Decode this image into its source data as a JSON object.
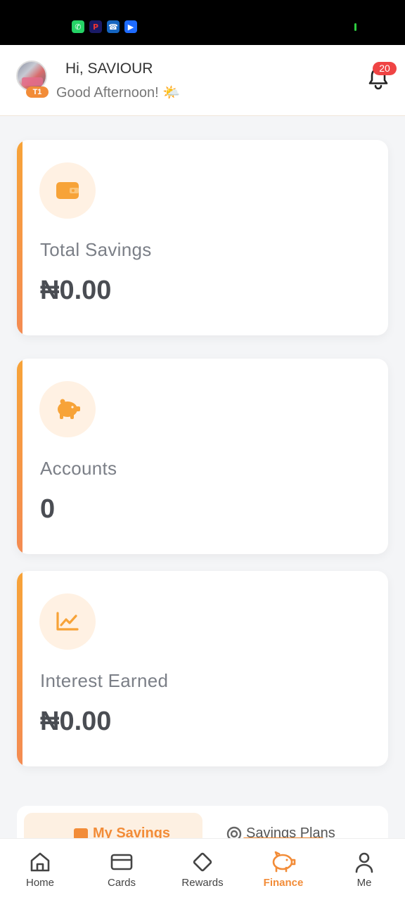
{
  "status_bar": {
    "icons": [
      "whatsapp-icon",
      "pinterest-icon",
      "phone-app-icon",
      "youtube-icon"
    ]
  },
  "header": {
    "greeting": "Hi, SAVIOUR",
    "subtitle": "Good Afternoon! 🌤️",
    "tier_badge": "T1",
    "notification_count": "20"
  },
  "stats": [
    {
      "label": "Total Savings",
      "value": "₦0.00",
      "icon": "wallet-icon"
    },
    {
      "label": "Accounts",
      "value": "0",
      "icon": "piggy-bank-icon"
    },
    {
      "label": "Interest Earned",
      "value": "₦0.00",
      "icon": "chart-line-icon"
    }
  ],
  "tabs": {
    "active": "My Savings",
    "other": "Savings Plans"
  },
  "bottom_nav": [
    {
      "label": "Home",
      "icon": "home-icon"
    },
    {
      "label": "Cards",
      "icon": "card-icon"
    },
    {
      "label": "Rewards",
      "icon": "diamond-icon"
    },
    {
      "label": "Finance",
      "icon": "piggy-bank-icon",
      "active": true
    },
    {
      "label": "Me",
      "icon": "user-icon"
    }
  ],
  "colors": {
    "accent": "#f28c38",
    "badge": "#ef4444",
    "icon_bg": "#fff1e3"
  }
}
